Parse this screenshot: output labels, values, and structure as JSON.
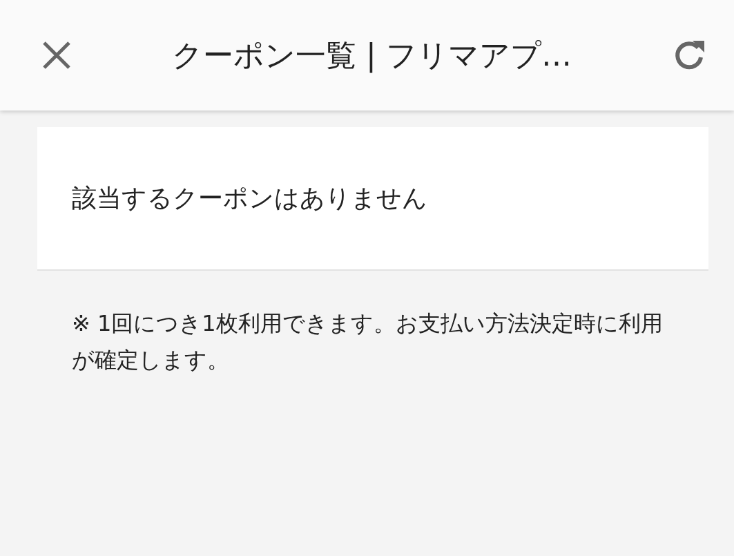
{
  "header": {
    "title": "クーポン一覧 | フリマアプ…"
  },
  "coupon_card": {
    "message": "該当するクーポンはありません"
  },
  "note": "※ 1回につき1枚利用できます。お支払い方法決定時に利用が確定します。"
}
